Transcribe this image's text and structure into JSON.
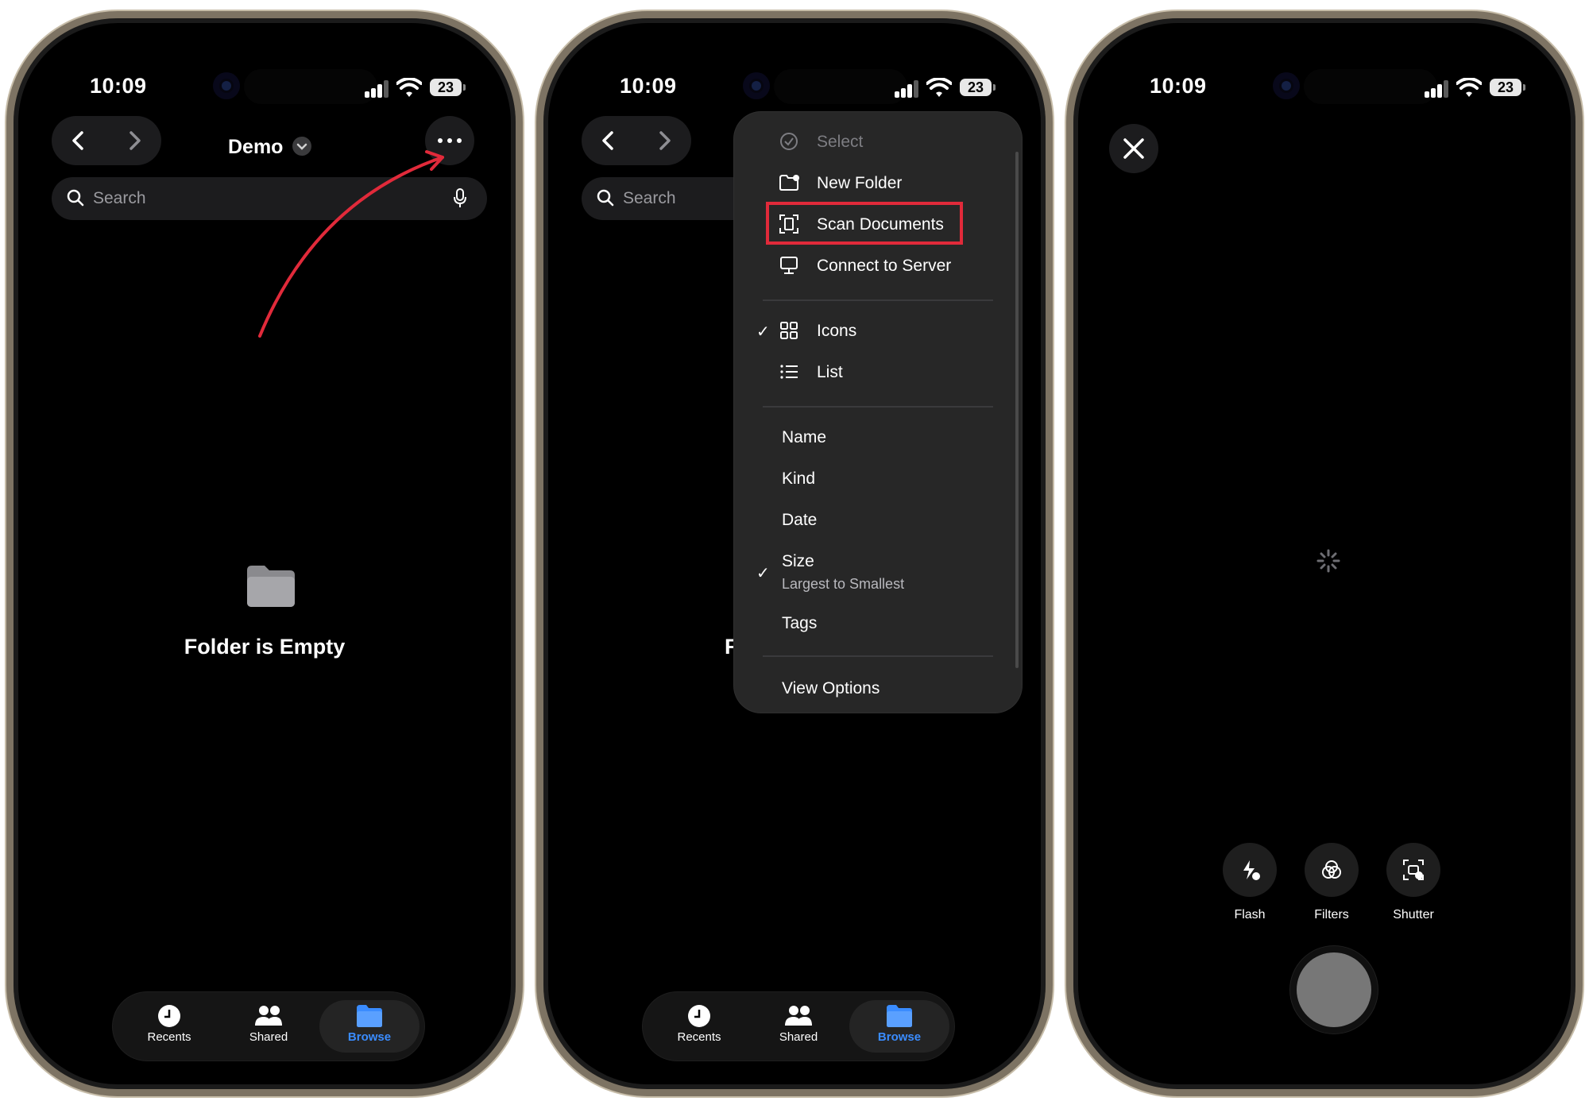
{
  "status": {
    "time": "10:09",
    "battery": "23"
  },
  "screen1": {
    "title": "Demo",
    "search_placeholder": "Search",
    "empty_title": "Folder is Empty",
    "tabs": [
      {
        "label": "Recents"
      },
      {
        "label": "Shared"
      },
      {
        "label": "Browse"
      }
    ]
  },
  "screen2": {
    "search_placeholder": "Search",
    "partial_empty_text": "F",
    "menu": {
      "actions": [
        {
          "label": "Select",
          "icon": "checkmark-circle-icon",
          "disabled": true
        },
        {
          "label": "New Folder",
          "icon": "new-folder-icon"
        },
        {
          "label": "Scan Documents",
          "icon": "scan-documents-icon",
          "highlighted": true
        },
        {
          "label": "Connect to Server",
          "icon": "monitor-icon"
        }
      ],
      "view": [
        {
          "label": "Icons",
          "icon": "grid-icon",
          "checked": true
        },
        {
          "label": "List",
          "icon": "list-icon"
        }
      ],
      "sort": [
        {
          "label": "Name"
        },
        {
          "label": "Kind"
        },
        {
          "label": "Date"
        },
        {
          "label": "Size",
          "subtitle": "Largest to Smallest",
          "checked": true
        },
        {
          "label": "Tags"
        }
      ],
      "footer": "View Options"
    },
    "tabs": [
      {
        "label": "Recents"
      },
      {
        "label": "Shared"
      },
      {
        "label": "Browse"
      }
    ]
  },
  "screen3": {
    "controls": [
      {
        "label": "Flash",
        "icon": "flash-auto-icon"
      },
      {
        "label": "Filters",
        "icon": "filters-icon"
      },
      {
        "label": "Shutter",
        "icon": "auto-shutter-icon"
      }
    ]
  },
  "colors": {
    "accent": "#3a8cff",
    "highlight": "#e12a3a",
    "frame": "#7d7363"
  }
}
